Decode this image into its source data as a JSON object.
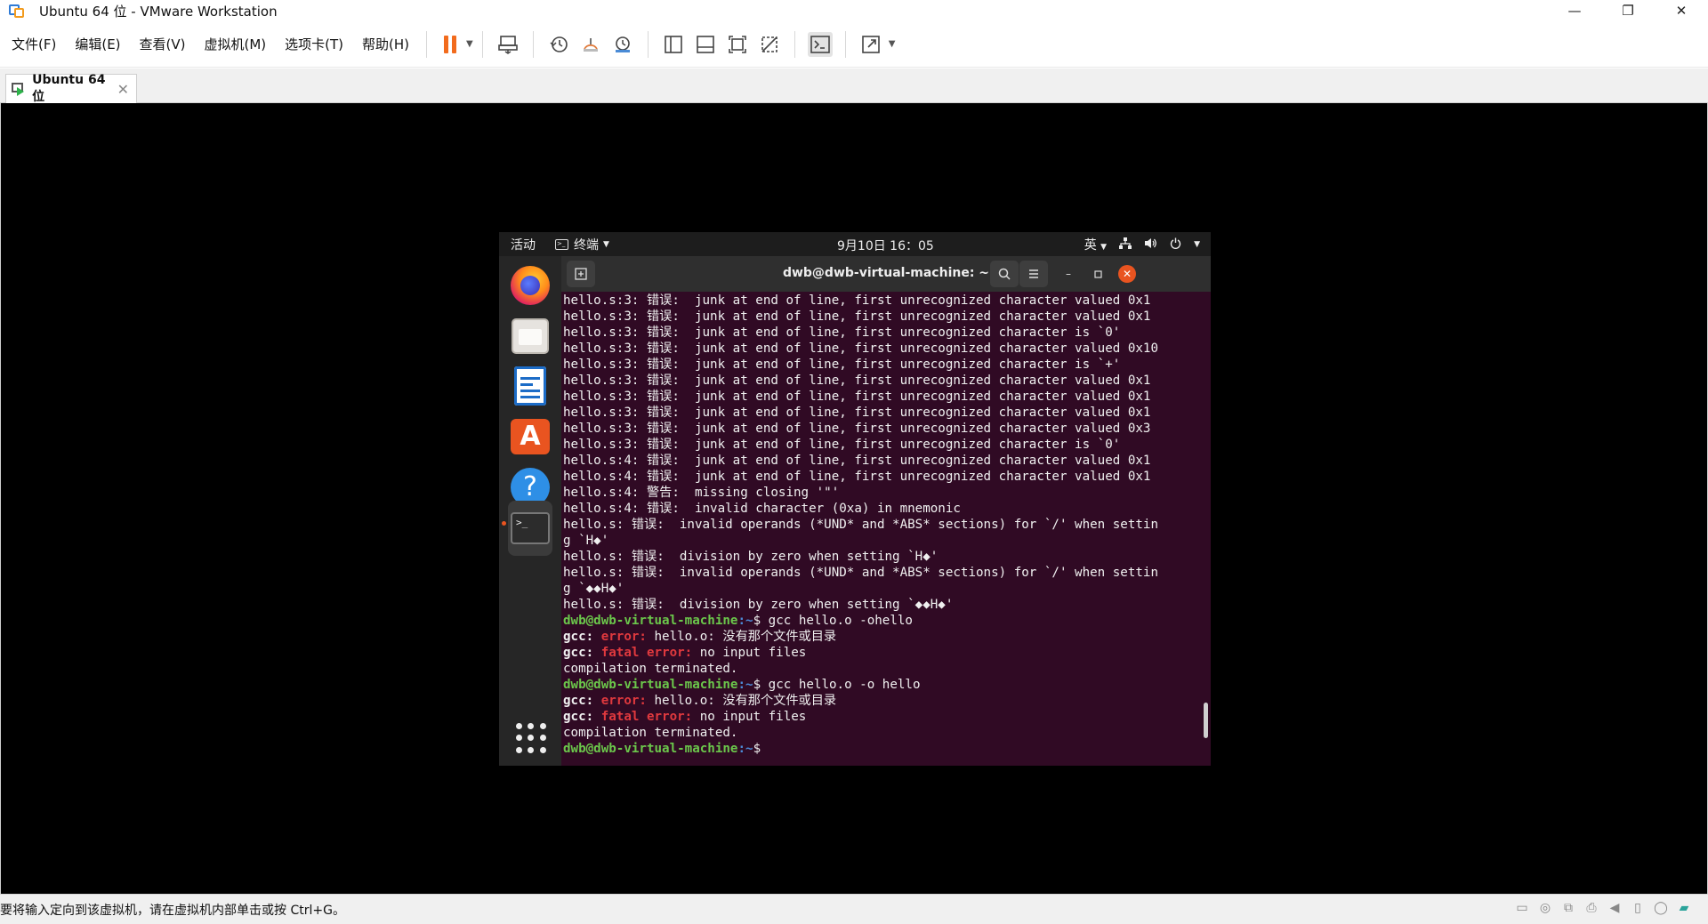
{
  "window": {
    "title": "Ubuntu 64 位 - VMware Workstation",
    "minimize": "—",
    "restore": "❐",
    "close": "✕"
  },
  "menu": [
    "文件(F)",
    "编辑(E)",
    "查看(V)",
    "虚拟机(M)",
    "选项卡(T)",
    "帮助(H)"
  ],
  "tab": {
    "label": "Ubuntu 64 位",
    "close": "✕"
  },
  "gnome": {
    "activities": "活动",
    "app_menu": "终端",
    "clock": "9月10日 16：05",
    "input_method": "英",
    "dock_icons": [
      "firefox-icon",
      "files-icon",
      "libreoffice-writer-icon",
      "ubuntu-software-icon",
      "help-icon",
      "terminal-icon",
      "show-applications-icon"
    ]
  },
  "terminal": {
    "title": "dwb@dwb-virtual-machine: ~",
    "lines": [
      {
        "text": "hello.s:3: 错误:  junk at end of line, first unrecognized character valued 0x1"
      },
      {
        "text": "hello.s:3: 错误:  junk at end of line, first unrecognized character valued 0x1"
      },
      {
        "text": "hello.s:3: 错误:  junk at end of line, first unrecognized character is `0'"
      },
      {
        "text": "hello.s:3: 错误:  junk at end of line, first unrecognized character valued 0x10"
      },
      {
        "text": "hello.s:3: 错误:  junk at end of line, first unrecognized character is `+'"
      },
      {
        "text": "hello.s:3: 错误:  junk at end of line, first unrecognized character valued 0x1"
      },
      {
        "text": "hello.s:3: 错误:  junk at end of line, first unrecognized character valued 0x1"
      },
      {
        "text": "hello.s:3: 错误:  junk at end of line, first unrecognized character valued 0x1"
      },
      {
        "text": "hello.s:3: 错误:  junk at end of line, first unrecognized character valued 0x3"
      },
      {
        "text": "hello.s:3: 错误:  junk at end of line, first unrecognized character is `0'"
      },
      {
        "text": "hello.s:4: 错误:  junk at end of line, first unrecognized character valued 0x1"
      },
      {
        "text": "hello.s:4: 错误:  junk at end of line, first unrecognized character valued 0x1"
      },
      {
        "text": "hello.s:4: 警告:  missing closing '\"'"
      },
      {
        "text": "hello.s:4: 错误:  invalid character (0xa) in mnemonic"
      },
      {
        "text": "hello.s: 错误:  invalid operands (*UND* and *ABS* sections) for `/' when settin"
      },
      {
        "text": "g `H◆'"
      },
      {
        "text": "hello.s: 错误:  division by zero when setting `H◆'"
      },
      {
        "text": "hello.s: 错误:  invalid operands (*UND* and *ABS* sections) for `/' when settin"
      },
      {
        "text": "g `◆◆H◆'"
      },
      {
        "text": "hello.s: 错误:  division by zero when setting `◆◆H◆'"
      }
    ],
    "prompt_user": "dwb@dwb-virtual-machine",
    "prompt_path": ":~",
    "prompt_sym": "$ ",
    "cmd1": "gcc hello.o -ohello",
    "cmd2": "gcc hello.o -o hello",
    "gcc_label": "gcc: ",
    "error_label": "error: ",
    "fatal_label": "fatal error: ",
    "no_file_msg": "hello.o: 没有那个文件或目录",
    "no_input_msg": "no input files",
    "terminated": "compilation terminated."
  },
  "status": {
    "text": "要将输入定向到该虚拟机，请在虚拟机内部单击或按 Ctrl+G。"
  }
}
